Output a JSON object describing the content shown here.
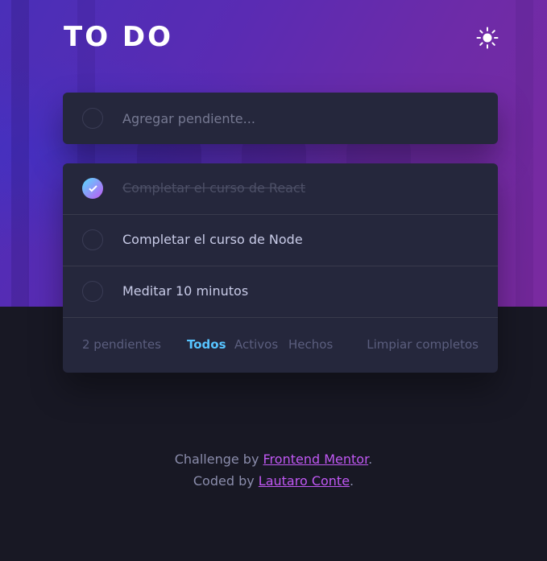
{
  "header": {
    "title": "TO DO",
    "theme_icon": "sun-icon"
  },
  "new_todo": {
    "placeholder": "Agregar pendiente..."
  },
  "todos": [
    {
      "text": "Completar el curso de React",
      "completed": true
    },
    {
      "text": "Completar el curso de Node",
      "completed": false
    },
    {
      "text": "Meditar 10 minutos",
      "completed": false
    }
  ],
  "footer": {
    "count_label": "2 pendientes",
    "filters": [
      {
        "label": "Todos",
        "active": true
      },
      {
        "label": "Activos",
        "active": false
      },
      {
        "label": "Hechos",
        "active": false
      }
    ],
    "clear_label": "Limpiar completos"
  },
  "attribution": {
    "line1_prefix": "Challenge by ",
    "line1_link": "Frontend Mentor",
    "line1_suffix": ".",
    "line2_prefix": "Coded by ",
    "line2_link": "Lautaro Conte",
    "line2_suffix": "."
  },
  "colors": {
    "background": "#181824",
    "card": "#25273c",
    "accent": "#57c4ff",
    "link": "#c058f3",
    "check_gradient_start": "#57ddff",
    "check_gradient_end": "#c058f3"
  }
}
